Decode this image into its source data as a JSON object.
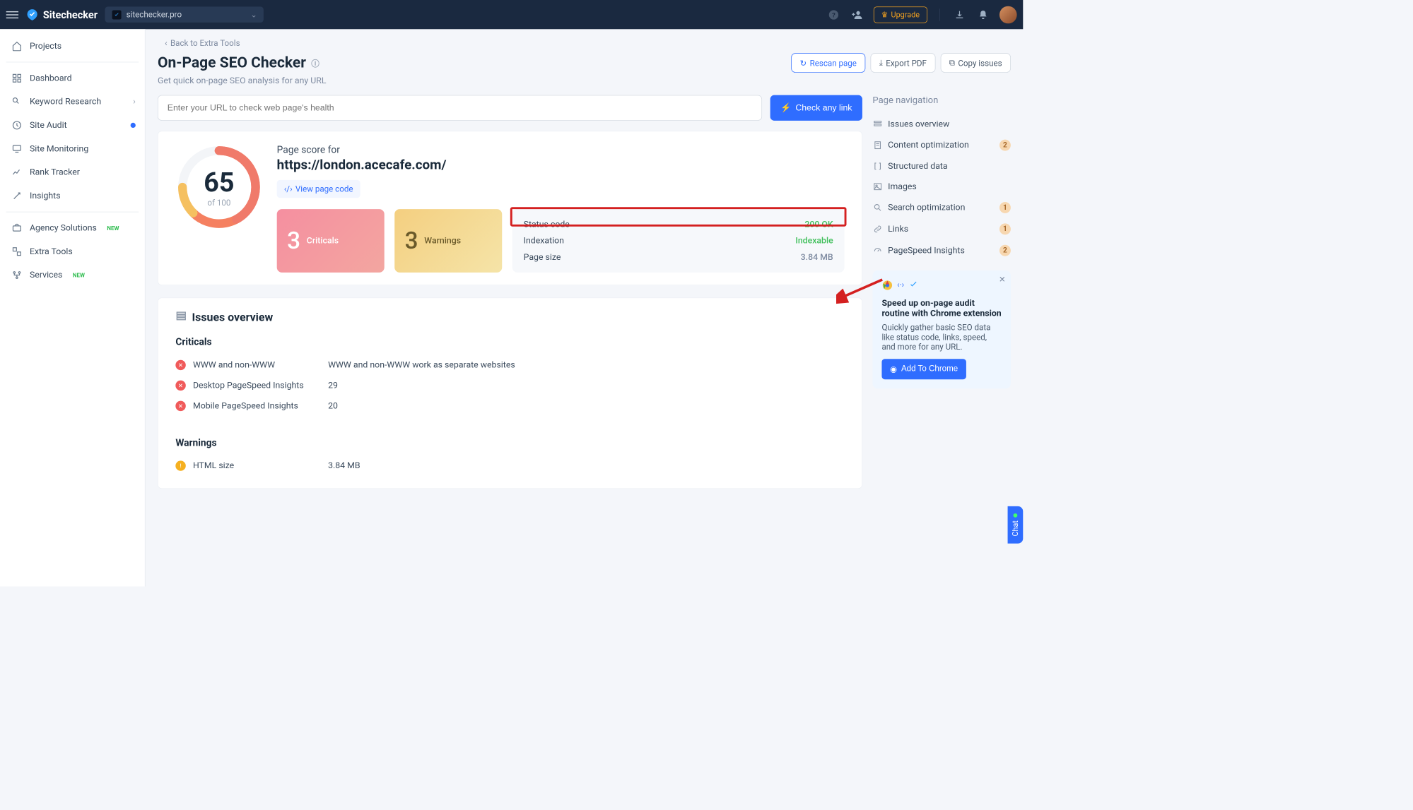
{
  "header": {
    "brand": "Sitechecker",
    "site_dropdown": "sitechecker.pro",
    "upgrade": "Upgrade"
  },
  "sidebar": {
    "projects": "Projects",
    "dashboard": "Dashboard",
    "keyword_research": "Keyword Research",
    "site_audit": "Site Audit",
    "site_monitoring": "Site Monitoring",
    "rank_tracker": "Rank Tracker",
    "insights": "Insights",
    "agency_solutions": "Agency Solutions",
    "extra_tools": "Extra Tools",
    "services": "Services",
    "new_badge": "NEW"
  },
  "page": {
    "back": "Back to Extra Tools",
    "title": "On-Page SEO Checker",
    "subtitle": "Get quick on-page SEO analysis for any URL",
    "url_placeholder": "Enter your URL to check web page's health",
    "check_btn": "Check any link",
    "rescan": "Rescan page",
    "export_pdf": "Export PDF",
    "copy_issues": "Copy issues"
  },
  "score": {
    "value": "65",
    "of": "of 100",
    "label": "Page score for",
    "url": "https://london.acecafe.com/",
    "view_code": "View page code"
  },
  "stats": {
    "criticals_n": "3",
    "criticals_l": "Criticals",
    "warnings_n": "3",
    "warnings_l": "Warnings"
  },
  "meta": {
    "status_k": "Status code",
    "status_v": "200 OK",
    "index_k": "Indexation",
    "index_v": "Indexable",
    "size_k": "Page size",
    "size_v": "3.84 MB"
  },
  "issues": {
    "overview_title": "Issues overview",
    "criticals_title": "Criticals",
    "warnings_title": "Warnings",
    "rows": {
      "www_k": "WWW and non-WWW",
      "www_v": "WWW and non-WWW work as separate websites",
      "desk_k": "Desktop PageSpeed Insights",
      "desk_v": "29",
      "mob_k": "Mobile PageSpeed Insights",
      "mob_v": "20",
      "html_k": "HTML size",
      "html_v": "3.84 MB"
    }
  },
  "pnav": {
    "title": "Page navigation",
    "issues_overview": "Issues overview",
    "content_opt": "Content optimization",
    "content_opt_n": "2",
    "structured": "Structured data",
    "images": "Images",
    "search_opt": "Search optimization",
    "search_opt_n": "1",
    "links": "Links",
    "links_n": "1",
    "pagespeed": "PageSpeed Insights",
    "pagespeed_n": "2"
  },
  "promo": {
    "title": "Speed up on-page audit routine with Chrome extension",
    "text": "Quickly gather basic SEO data like status code, links, speed, and more for any URL.",
    "btn": "Add To Chrome"
  },
  "chat": "Chat"
}
